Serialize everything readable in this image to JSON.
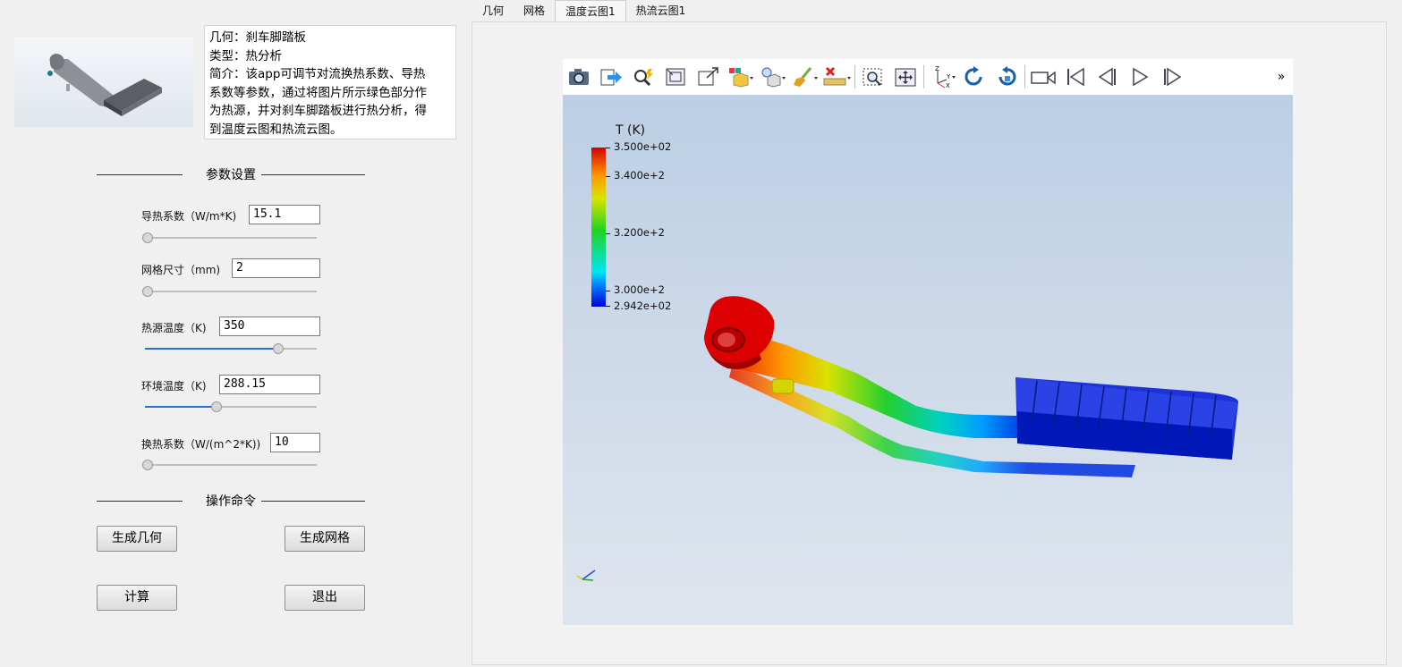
{
  "tabs": [
    "几何",
    "网格",
    "温度云图1",
    "热流云图1"
  ],
  "active_tab": 2,
  "description": {
    "line1": "几何：刹车脚踏板",
    "line2": "类型：热分析",
    "line3": "简介：该app可调节对流换热系数、导热",
    "line4": "系数等参数，通过将图片所示绿色部分作",
    "line5": "为热源，并对刹车脚踏板进行热分析，得",
    "line6": "到温度云图和热流云图。"
  },
  "sections": {
    "params": "参数设置",
    "commands": "操作命令"
  },
  "params": [
    {
      "label": "导热系数（W/m*K)",
      "value": "15.1",
      "slider_fraction": 0.0
    },
    {
      "label": "网格尺寸（mm)",
      "value": "2",
      "slider_fraction": 0.0
    },
    {
      "label": "热源温度（K)",
      "value": "350",
      "slider_fraction": 0.77
    },
    {
      "label": "环境温度（K)",
      "value": "288.15",
      "slider_fraction": 0.41
    },
    {
      "label": "换热系数（W/(m^2*K))",
      "value": "10",
      "slider_fraction": 0.0
    }
  ],
  "buttons": {
    "gen_geometry": "生成几何",
    "gen_mesh": "生成网格",
    "compute": "计算",
    "exit": "退出"
  },
  "viewer": {
    "toolbar_icons": [
      "camera-icon",
      "export-icon",
      "zoom-pick-icon",
      "fit-view-icon",
      "maximize-icon",
      "display-mode-icon",
      "lighting-icon",
      "clear-icon",
      "delete-icon",
      "ruler-icon",
      "zoom-box-icon",
      "pan-icon",
      "axes-icon",
      "rotate-cw-icon",
      "rotate-ccw-icon",
      "record-icon",
      "first-frame-icon",
      "prev-frame-icon",
      "play-icon",
      "last-frame-icon"
    ],
    "more_label": "»",
    "legend": {
      "title": "T (K)",
      "ticks": [
        "3.500e+02",
        "3.400e+2",
        "3.200e+2",
        "3.000e+2",
        "2.942e+02"
      ],
      "colors": [
        "#d40000",
        "#ff9a00",
        "#21d321",
        "#00e5f5",
        "#0000d0"
      ]
    }
  }
}
